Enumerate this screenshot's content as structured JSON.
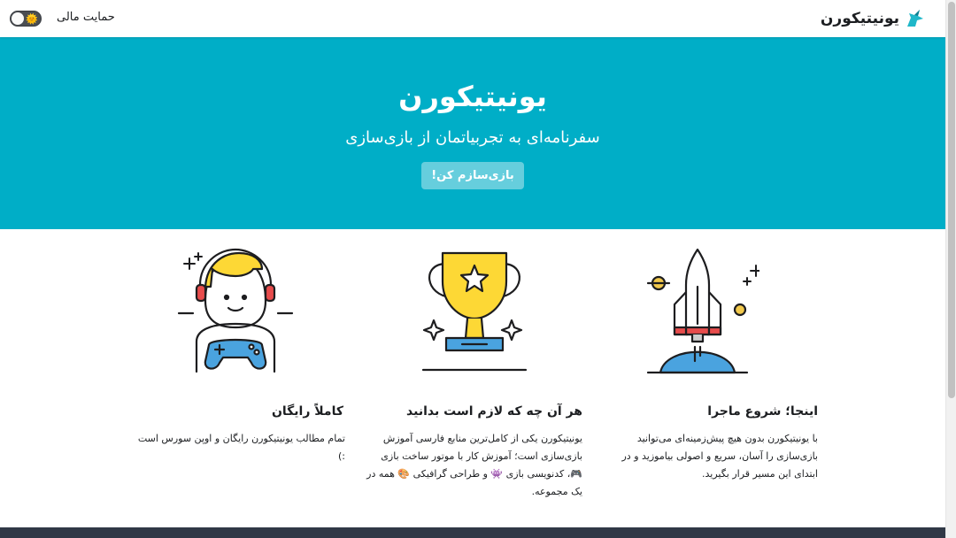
{
  "navbar": {
    "brand_title": "یونیتیکورن",
    "donate_label": "حمایت مالی",
    "theme_toggle_symbol": "🌞"
  },
  "hero": {
    "title": "یونیتیکورن",
    "subtitle": "سفرنامه‌ای به تجربیاتمان از بازی‌سازی",
    "cta_label": "بازی‌سازم کن!"
  },
  "features": [
    {
      "title": "اینجا؛ شروع ماجرا",
      "text": "با یونیتیکورن بدون هیچ پیش‌زمینه‌ای می‌توانید بازی‌سازی را آسان، سریع و اصولی بیاموزید و در ابتدای این مسیر قرار بگیرید.",
      "icon": "rocket-icon"
    },
    {
      "title": "هر آن چه که لازم است بدانید",
      "text": "یونیتیکورن یکی از کامل‌ترین منابع فارسی آموزش بازی‌سازی است؛ آموزش کار با موتور ساخت بازی 🎮، کدنویسی بازی 👾 و طراحی گرافیکی 🎨 همه در یک مجموعه.",
      "icon": "trophy-icon"
    },
    {
      "title": "کاملاً رایگان",
      "text": "تمام مطالب یونیتیکورن رایگان و اوپن سورس است :)",
      "icon": "gamer-icon"
    }
  ],
  "colors": {
    "hero_background": "#00aec7",
    "hero_button": "#66cedd",
    "brand_accent": "#1fb7c9",
    "footer": "#303846"
  }
}
